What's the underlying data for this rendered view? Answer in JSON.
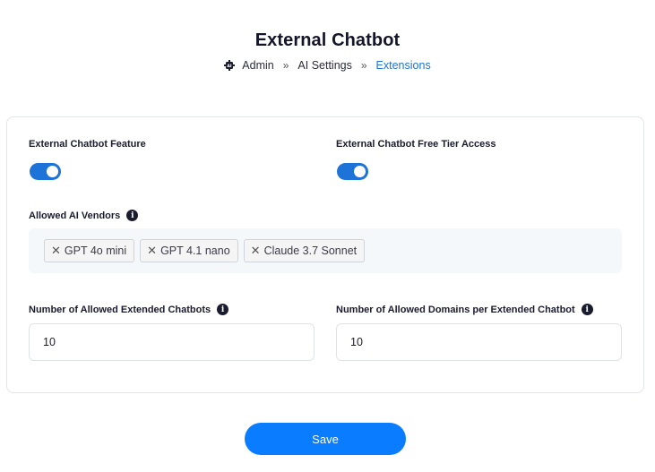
{
  "page": {
    "title": "External Chatbot"
  },
  "breadcrumb": {
    "home_icon": "ai-chip-icon",
    "items": [
      "Admin",
      "AI Settings",
      "Extensions"
    ],
    "separator": "»"
  },
  "settings": {
    "external_feature": {
      "label": "External Chatbot Feature",
      "enabled": true
    },
    "free_tier": {
      "label": "External Chatbot Free Tier Access",
      "enabled": true
    },
    "vendors": {
      "label": "Allowed AI Vendors",
      "tags": [
        "GPT 4o mini",
        "GPT 4.1 nano",
        "Claude 3.7 Sonnet"
      ]
    },
    "extended_chatbots": {
      "label": "Number of Allowed Extended Chatbots",
      "value": "10"
    },
    "domains_per_chatbot": {
      "label": "Number of Allowed Domains per Extended Chatbot",
      "value": "10"
    }
  },
  "actions": {
    "save_label": "Save"
  },
  "colors": {
    "accent": "#0a7cff",
    "link": "#1e73d8",
    "toggle_on": "#1e73d8"
  }
}
